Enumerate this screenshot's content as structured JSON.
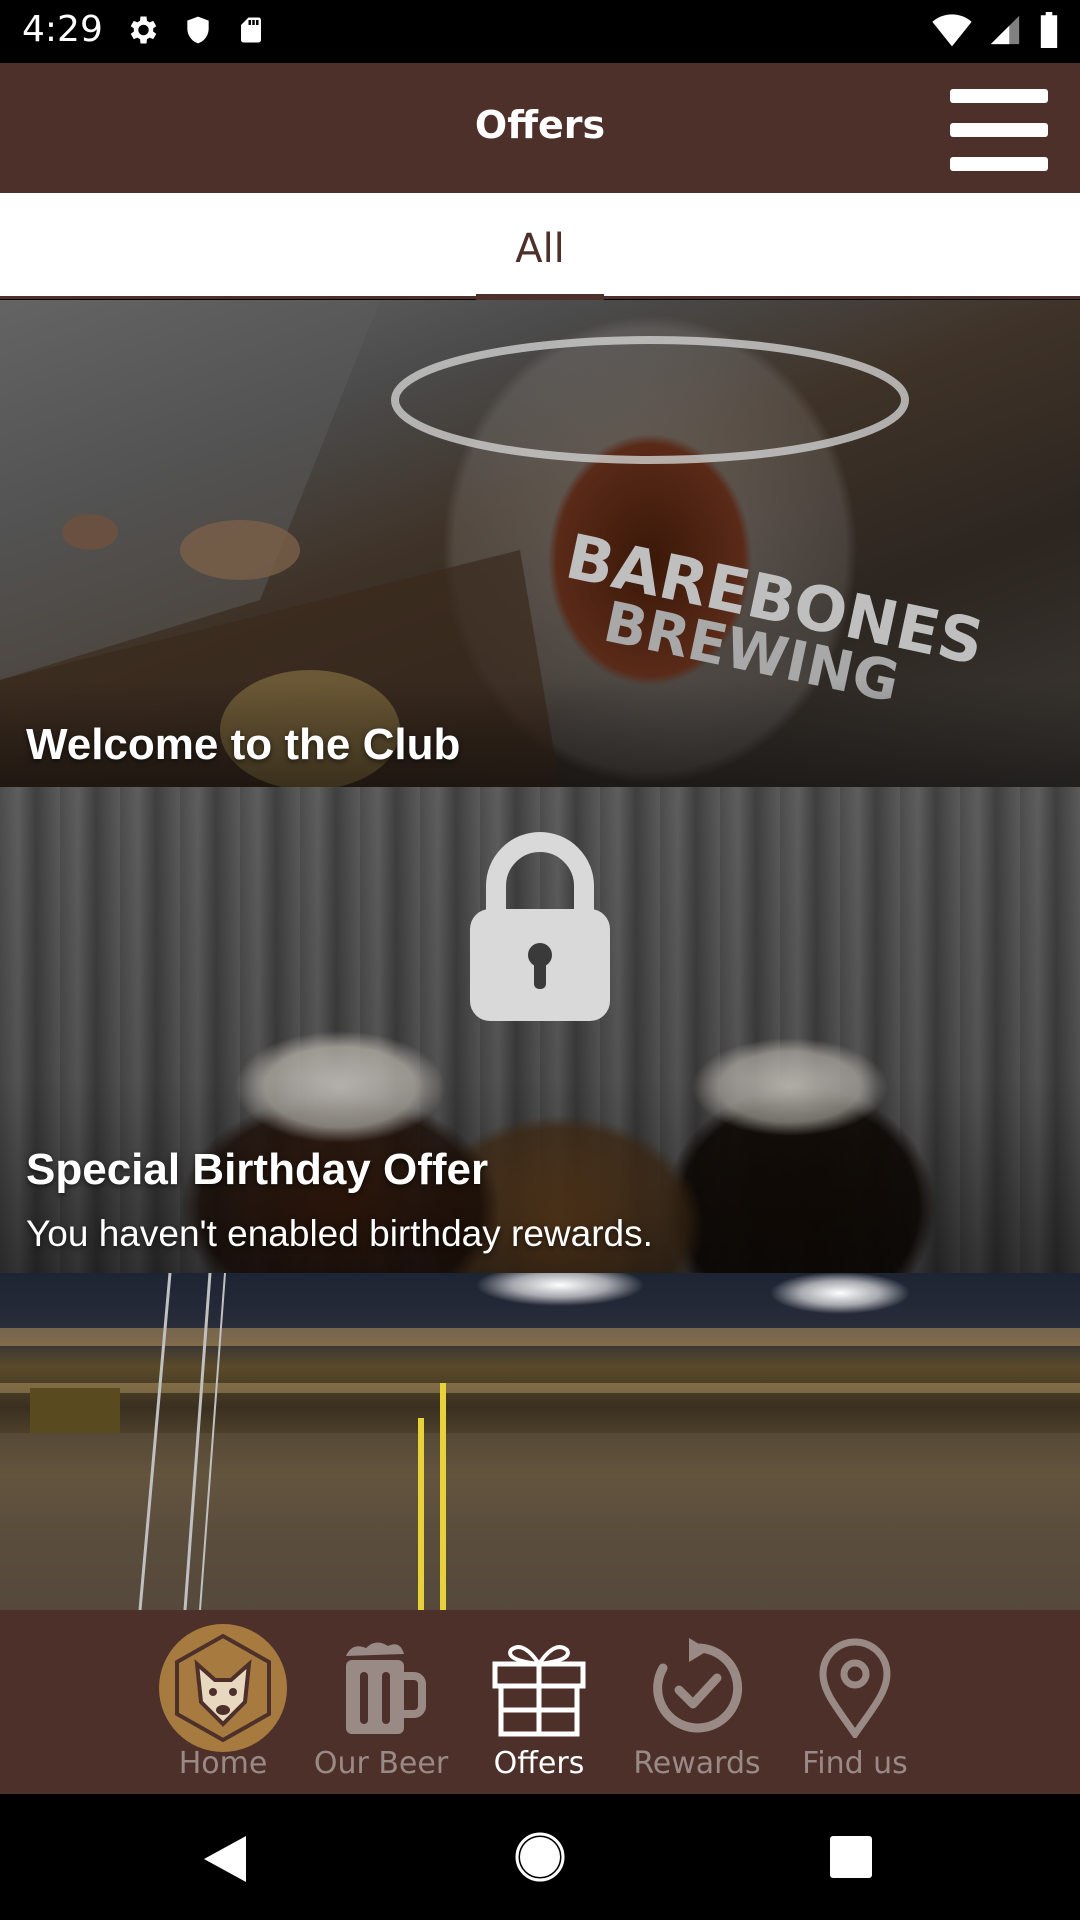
{
  "status_bar": {
    "time": "4:29",
    "left_icons": [
      "gear-icon",
      "shield-icon",
      "sd-card-icon"
    ],
    "right_icons": [
      "wifi-icon",
      "signal-icon",
      "battery-icon"
    ]
  },
  "app_bar": {
    "title": "Offers",
    "menu_icon": "hamburger-menu-icon"
  },
  "tabs": [
    {
      "label": "All",
      "selected": true
    }
  ],
  "offers": [
    {
      "title": "Welcome to the Club",
      "subtitle": "",
      "locked": false
    },
    {
      "title": "Special Birthday Offer",
      "subtitle": "You haven't enabled birthday rewards.",
      "locked": true
    },
    {
      "title": "",
      "subtitle": "",
      "locked": false
    }
  ],
  "bottom_nav": [
    {
      "label": "Home",
      "icon": "dog-logo-icon",
      "active": false
    },
    {
      "label": "Our Beer",
      "icon": "beer-mug-icon",
      "active": false
    },
    {
      "label": "Offers",
      "icon": "gift-icon",
      "active": true
    },
    {
      "label": "Rewards",
      "icon": "refresh-check-icon",
      "active": false
    },
    {
      "label": "Find us",
      "icon": "location-pin-icon",
      "active": false
    }
  ],
  "system_nav": [
    "back-icon",
    "home-icon",
    "recents-icon"
  ],
  "colors": {
    "primary": "#4d302a",
    "home_badge": "#a77b3f",
    "inactive_label": "#9a8a85",
    "active_label": "#ffffff"
  }
}
